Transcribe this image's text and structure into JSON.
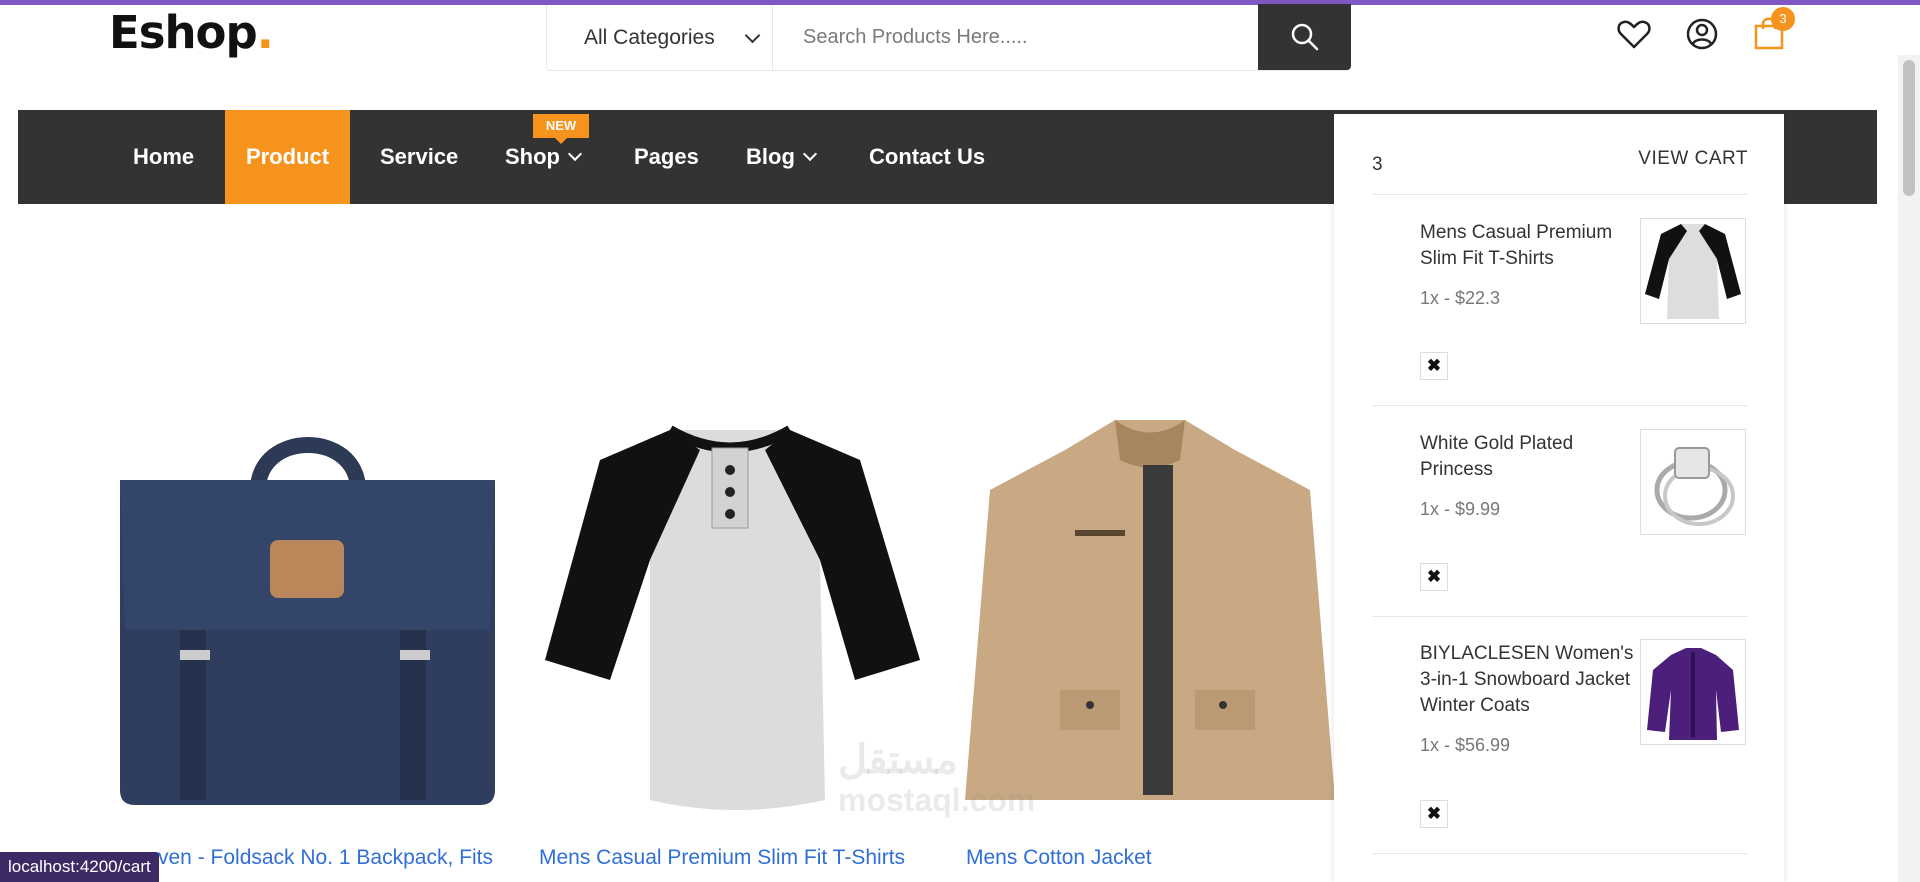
{
  "brand": {
    "name": "Eshop",
    "dot": "."
  },
  "search": {
    "category": "All Categories",
    "placeholder": "Search Products Here....."
  },
  "header_icons": {
    "wishlist": "heart-icon",
    "account": "user-icon",
    "cart": "shopping-bag-icon",
    "cart_count": "3"
  },
  "nav": {
    "items": [
      {
        "label": "Home"
      },
      {
        "label": "Product"
      },
      {
        "label": "Service"
      },
      {
        "label": "Shop"
      },
      {
        "label": "Pages"
      },
      {
        "label": "Blog"
      },
      {
        "label": "Contact Us"
      }
    ],
    "new_badge": "NEW",
    "active": "Product"
  },
  "products": [
    {
      "title": "ven - Foldsack No. 1 Backpack, Fits"
    },
    {
      "title": "Mens Casual Premium Slim Fit T-Shirts"
    },
    {
      "title": "Mens Cotton Jacket"
    }
  ],
  "cart_panel": {
    "count": "3",
    "view_cart": "VIEW CART",
    "items": [
      {
        "name": "Mens Casual Premium Slim Fit T-Shirts",
        "qty_price": "1x - $22.3",
        "remove": "✖"
      },
      {
        "name": "White Gold Plated Princess",
        "qty_price": "1x - $9.99",
        "remove": "✖"
      },
      {
        "name": "BIYLACLESEN Women's 3-in-1 Snowboard Jacket Winter Coats",
        "qty_price": "1x - $56.99",
        "remove": "✖"
      }
    ]
  },
  "watermark": {
    "ar": "مستقل",
    "en": "mostaql.com"
  },
  "status_bar": {
    "url": "localhost:4200/cart"
  },
  "colors": {
    "accent": "#f6931d",
    "nav_bg": "#333333",
    "link": "#2f6fd6",
    "top_line": "#7e57c2"
  }
}
